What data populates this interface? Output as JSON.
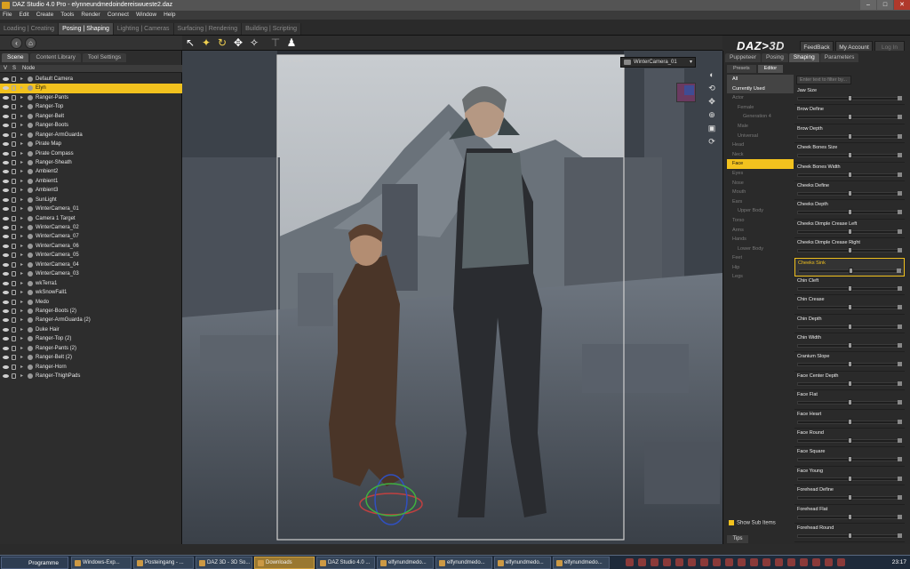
{
  "window": {
    "title": "DAZ Studio 4.0 Pro - elynneundmedoindereiswueste2.daz"
  },
  "menu": [
    "File",
    "Edit",
    "Create",
    "Tools",
    "Render",
    "Connect",
    "Window",
    "Help"
  ],
  "rooms": [
    "Loading | Creating",
    "Posing | Shaping",
    "Lighting | Cameras",
    "Surfacing | Rendering",
    "Building | Scripting"
  ],
  "logo": {
    "text": "DAZ",
    "suffix": "3D"
  },
  "topbuttons": {
    "feedback": "FeedBack",
    "account": "My Account",
    "login": "Log In"
  },
  "left_tabs": [
    "Scene",
    "Content Library",
    "Tool Settings"
  ],
  "scene_header": {
    "v": "V",
    "s": "S",
    "node": "Node"
  },
  "scene_nodes": [
    "Default Camera",
    "Elyn",
    "Ranger-Pants",
    "Ranger-Top",
    "Ranger-Belt",
    "Ranger-Boots",
    "Ranger-ArmGuarda",
    "Pirate Map",
    "Pirate Compass",
    "Ranger-Sheath",
    "Ambient2",
    "Ambient1",
    "Ambient3",
    "SunLight",
    "WinterCamera_01",
    "Camera 1 Target",
    "WinterCamera_02",
    "WinterCamera_07",
    "WinterCamera_06",
    "WinterCamera_05",
    "WinterCamera_04",
    "WinterCamera_03",
    "wkTerra1",
    "wkSnowFall1",
    "Medo",
    "Ranger-Boots (2)",
    "Ranger-ArmGuarda (2)",
    "Duke Hair",
    "Ranger-Top (2)",
    "Ranger-Pants (2)",
    "Ranger-Belt (2)",
    "Ranger-Horn",
    "Ranger-ThighPads"
  ],
  "viewport": {
    "camera": "WinterCamera_01",
    "ratio": "1 : 1.4142"
  },
  "right_tabs": [
    "Puppeteer",
    "Posing",
    "Shaping",
    "Parameters"
  ],
  "sub_tabs": [
    "Presets",
    "Editor"
  ],
  "categories": [
    {
      "label": "All",
      "style": "hl"
    },
    {
      "label": "Currently Used",
      "style": "hl"
    },
    {
      "label": "Actor",
      "style": ""
    },
    {
      "label": "Female",
      "style": "sub"
    },
    {
      "label": "Generation 4",
      "style": "sub2"
    },
    {
      "label": "Male",
      "style": "sub"
    },
    {
      "label": "Universal",
      "style": "sub"
    },
    {
      "label": "Head",
      "style": ""
    },
    {
      "label": "Neck",
      "style": ""
    },
    {
      "label": "Face",
      "style": "sel"
    },
    {
      "label": "Eyes",
      "style": ""
    },
    {
      "label": "Nose",
      "style": ""
    },
    {
      "label": "Mouth",
      "style": ""
    },
    {
      "label": "Ears",
      "style": ""
    },
    {
      "label": "Upper Body",
      "style": "sub"
    },
    {
      "label": "Torso",
      "style": ""
    },
    {
      "label": "Arms",
      "style": ""
    },
    {
      "label": "Hands",
      "style": ""
    },
    {
      "label": "Lower Body",
      "style": "sub"
    },
    {
      "label": "Feet",
      "style": ""
    },
    {
      "label": "Hip",
      "style": ""
    },
    {
      "label": "Legs",
      "style": ""
    }
  ],
  "filter_placeholder": "Enter text to filter by...",
  "sliders": [
    {
      "label": "Jaw Size",
      "value": 0.0
    },
    {
      "label": "Brow Define",
      "value": 0.0
    },
    {
      "label": "Brow Depth",
      "value": 0.0
    },
    {
      "label": "Cheek Bones Size",
      "value": 0.0
    },
    {
      "label": "Cheek Bones Width",
      "value": 0.0
    },
    {
      "label": "Cheeks Define",
      "value": 0.0
    },
    {
      "label": "Cheeks Depth",
      "value": 0.0
    },
    {
      "label": "Cheeks Dimple Crease Left",
      "value": 0.0
    },
    {
      "label": "Cheeks Dimple Crease Right",
      "value": 0.0
    },
    {
      "label": "Cheeks Sink",
      "value": 0.0
    },
    {
      "label": "Chin Cleft",
      "value": 0.0
    },
    {
      "label": "Chin Crease",
      "value": 0.0
    },
    {
      "label": "Chin Depth",
      "value": 0.0
    },
    {
      "label": "Chin Width",
      "value": 0.0
    },
    {
      "label": "Cranium Slope",
      "value": 0.0
    },
    {
      "label": "Face Center Depth",
      "value": 0.0
    },
    {
      "label": "Face Flat",
      "value": 0.0
    },
    {
      "label": "Face Heart",
      "value": 0.0
    },
    {
      "label": "Face Round",
      "value": 0.0
    },
    {
      "label": "Face Square",
      "value": 0.0
    },
    {
      "label": "Face Young",
      "value": 0.0
    },
    {
      "label": "Forehead Define",
      "value": 0.0
    },
    {
      "label": "Forehead Flat",
      "value": 0.0
    },
    {
      "label": "Forehead Round",
      "value": 0.0
    }
  ],
  "active_slider": "Cheeks Sink",
  "show_sub_items": "Show Sub Items",
  "tips": "Tips",
  "taskbar": {
    "start": "Programme",
    "items": [
      "Windows-Exp...",
      "Posteingang - ...",
      "DAZ 3D - 3D So...",
      "Downloads",
      "DAZ Studio 4.0 ...",
      "elfynundmedo...",
      "elfynundmedo...",
      "elfynundmedo...",
      "elfynundmedo..."
    ],
    "clock": "23:17"
  }
}
